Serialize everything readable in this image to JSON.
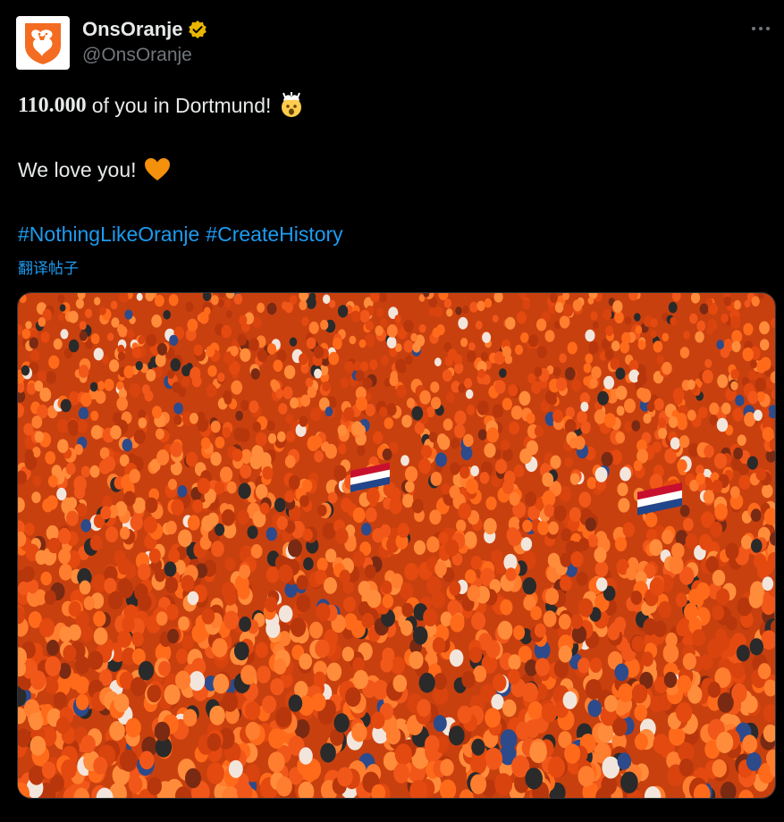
{
  "author": {
    "display_name": "OnsOranje",
    "handle": "@OnsOranje",
    "verified": true,
    "avatar_icon": "knvb-lion-crest-icon",
    "brand_color": "#f36c21"
  },
  "tweet": {
    "line1_number": "110.000",
    "line1_text": "of you in Dortmund!",
    "line1_emoji": "exploding-head-emoji",
    "line2_text": "We love you!",
    "line2_emoji": "orange-heart-emoji",
    "hashtags": [
      "#NothingLikeOranje",
      "#CreateHistory"
    ],
    "translate_label": "翻译帖子"
  },
  "media": {
    "alt": "",
    "icon": "crowd-photo"
  },
  "colors": {
    "background": "#000000",
    "text": "#e7e9ea",
    "secondary_text": "#71767b",
    "link": "#1d9bf0",
    "verified_badge": "#e8b600",
    "orange_crowd": "#f0621a"
  },
  "menu": {
    "more_icon": "more-horizontal-icon"
  }
}
